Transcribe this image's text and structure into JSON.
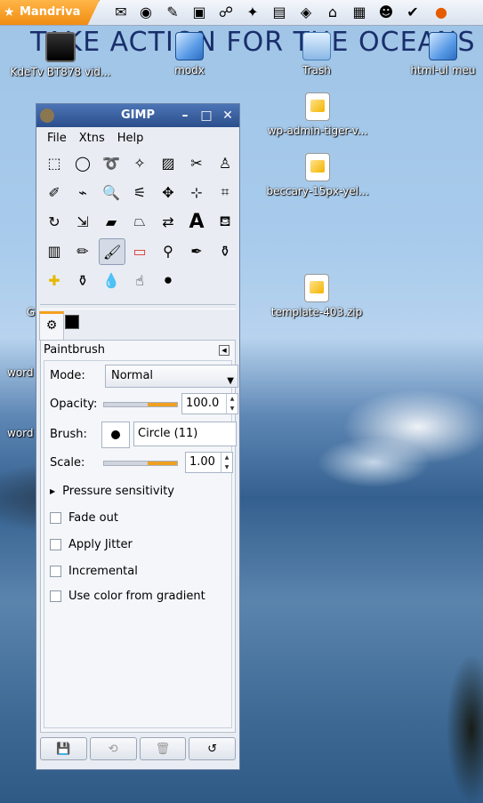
{
  "taskbar": {
    "start_label": "Mandriva",
    "launchers": [
      "mail-icon",
      "browser-icon",
      "editor-icon",
      "terminal-icon",
      "network-icon",
      "star-icon",
      "document-icon",
      "game-icon",
      "home-icon",
      "clipboard-icon",
      "user-icon",
      "tools-icon",
      "firefox-icon"
    ]
  },
  "wallpaper": {
    "banner_text": "TAKE ACTION FOR THE OCEANS"
  },
  "desktop": {
    "icons": [
      {
        "label": "KdeTv BT878 vid..."
      },
      {
        "label": "modx"
      },
      {
        "label": "Trash"
      },
      {
        "label": "html-ul meu"
      },
      {
        "label": "wp-admin-tiger-v..."
      },
      {
        "label": "beccary-15px-yel..."
      },
      {
        "label": "template-403.zip"
      },
      {
        "label": "word"
      },
      {
        "label": "word"
      },
      {
        "label": "G"
      }
    ]
  },
  "gimp": {
    "title": "GIMP",
    "menu": [
      "File",
      "Xtns",
      "Help"
    ],
    "tools": [
      "rect-select",
      "ellipse-select",
      "free-select",
      "fuzzy-select",
      "color-select",
      "scissors",
      "foreground-select",
      "paths",
      "color-picker",
      "zoom",
      "measure",
      "move",
      "align",
      "crop",
      "rotate",
      "scale",
      "shear",
      "perspective",
      "flip",
      "text",
      "bucket-fill",
      "blend",
      "pencil",
      "paintbrush",
      "eraser",
      "airbrush",
      "ink",
      "clone",
      "heal",
      "perspective-clone",
      "smudge",
      "dodge-burn",
      "convolve"
    ],
    "tool_options": {
      "title": "Paintbrush",
      "mode_label": "Mode:",
      "mode_value": "Normal",
      "opacity_label": "Opacity:",
      "opacity_value": "100.0",
      "brush_label": "Brush:",
      "brush_value": "Circle (11)",
      "scale_label": "Scale:",
      "scale_value": "1.00",
      "pressure_label": "Pressure sensitivity",
      "checkboxes": [
        "Fade out",
        "Apply Jitter",
        "Incremental",
        "Use color from gradient"
      ]
    }
  }
}
